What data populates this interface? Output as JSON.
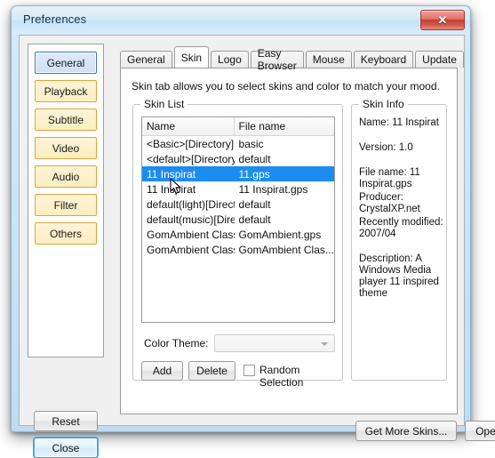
{
  "window": {
    "title": "Preferences",
    "close_glyph": "✕"
  },
  "sidebar": {
    "items": [
      {
        "label": "General"
      },
      {
        "label": "Playback"
      },
      {
        "label": "Subtitle"
      },
      {
        "label": "Video"
      },
      {
        "label": "Audio"
      },
      {
        "label": "Filter"
      },
      {
        "label": "Others"
      }
    ],
    "reset_label": "Reset",
    "close_label": "Close"
  },
  "tabs": [
    {
      "label": "General"
    },
    {
      "label": "Skin"
    },
    {
      "label": "Logo"
    },
    {
      "label": "Easy Browser"
    },
    {
      "label": "Mouse"
    },
    {
      "label": "Keyboard"
    },
    {
      "label": "Update"
    }
  ],
  "main": {
    "intro": "Skin tab allows you to select skins and color to match your mood.",
    "skin_list": {
      "group_label": "Skin List",
      "columns": [
        "Name",
        "File name"
      ],
      "rows": [
        {
          "name": "<Basic>[Directory]",
          "file": "basic",
          "selected": false
        },
        {
          "name": "<default>[Directory]",
          "file": "default",
          "selected": false
        },
        {
          "name": "11 Inspirat",
          "file": "11.gps",
          "selected": true
        },
        {
          "name": "11 Inspirat",
          "file": "11 Inspirat.gps",
          "selected": false
        },
        {
          "name": "default(light)[Direct...",
          "file": "default",
          "selected": false
        },
        {
          "name": "default(music)[Dire...",
          "file": "default",
          "selected": false
        },
        {
          "name": "GomAmbient Classic",
          "file": "GomAmbient.gps",
          "selected": false
        },
        {
          "name": "GomAmbient Classic",
          "file": "GomAmbient Clas...",
          "selected": false
        }
      ]
    },
    "color_theme": {
      "label": "Color Theme:",
      "value": "",
      "placeholder": ""
    },
    "add_label": "Add",
    "delete_label": "Delete",
    "random_selection_label": "Random Selection",
    "random_selection_checked": false,
    "skin_info": {
      "group_label": "Skin Info",
      "name": "Name: 11 Inspirat",
      "version": "Version: 1.0",
      "file_name": "File name: 11 Inspirat.gps",
      "producer": "Producer: CrystalXP.net",
      "recently_modified": "Recently modified: 2007/04",
      "description": "Description: A Windows Media player 11 inspired theme"
    },
    "get_more_skins_label": "Get More Skins...",
    "open_directory_label": "Open Directory..."
  },
  "colors": {
    "selection_blue": "#1c8cf0",
    "sidebar_cream": "#fbeec0",
    "sidebar_cream_border": "#e0a33c",
    "focus_blue": "#43b0ef",
    "close_red": "#c43f33"
  }
}
